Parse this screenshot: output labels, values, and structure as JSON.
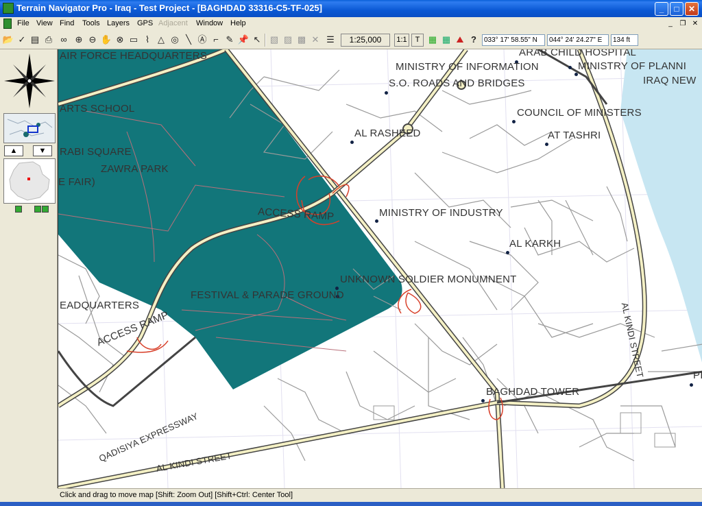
{
  "window": {
    "title": "Terrain Navigator Pro - Iraq - Test Project - [BAGHDAD 33316-C5-TF-025]",
    "controls": {
      "minimize": "_",
      "maximize": "□",
      "close": "✕"
    }
  },
  "menu": {
    "items": [
      "File",
      "View",
      "Find",
      "Tools",
      "Layers",
      "GPS",
      "Adjacent",
      "Window",
      "Help"
    ],
    "disabled": [
      "Adjacent"
    ],
    "mdi_controls": {
      "minimize": "_",
      "restore": "❐",
      "close": "✕"
    }
  },
  "toolbar": {
    "scale": "1:25,000",
    "ratio_button": "1:1",
    "text_button": "T",
    "help_button": "?",
    "latitude": "033° 17' 58.55\" N",
    "longitude": "044° 24' 24.27\" E",
    "elevation": "134 ft",
    "icons": [
      "open-folder-icon",
      "check-icon",
      "print-preview-icon",
      "print-icon",
      "binoculars-icon",
      "zoom-in-icon",
      "zoom-out-icon",
      "hand-pan-icon",
      "center-icon",
      "ruler-icon",
      "profile-icon",
      "triangle-icon",
      "target-icon",
      "line-icon",
      "text-tool-icon",
      "measure-icon",
      "pencil-icon",
      "pushpin-icon",
      "arrow-select-icon",
      "route-icon",
      "layer-icon",
      "terrain-icon",
      "delete-icon",
      "lines-icon"
    ]
  },
  "left_panel": {
    "up_arrow": "▲",
    "down_arrow": "▼",
    "compass_north": "N"
  },
  "map": {
    "labels": [
      {
        "text": "AIR FORCE HEADQUARTERS",
        "dot": false
      },
      {
        "text": "ARTS SCHOOL",
        "dot": false
      },
      {
        "text": "RABI SQUARE",
        "dot": false
      },
      {
        "text": "ZAWRA PARK",
        "dot": false
      },
      {
        "text": "E FAIR)",
        "dot": false
      },
      {
        "text": "ARAB CHILD HOSPITAL",
        "dot": true
      },
      {
        "text": "MINISTRY OF INFORMATION",
        "dot": false
      },
      {
        "text": "MINISTRY OF PLANNI",
        "dot": true
      },
      {
        "text": "IRAQ NEW",
        "dot": false
      },
      {
        "text": "S.O. ROADS AND BRIDGES",
        "dot": true
      },
      {
        "text": "COUNCIL OF MINISTERS",
        "dot": true
      },
      {
        "text": "AL RASHEED",
        "dot": true
      },
      {
        "text": "AT TASHRI",
        "dot": true
      },
      {
        "text": "ACCESS RAMP",
        "dot": false
      },
      {
        "text": "MINISTRY OF INDUSTRY",
        "dot": true
      },
      {
        "text": "AL KARKH",
        "dot": true
      },
      {
        "text": "UNKNOWN SOLDIER MONUMNENT",
        "dot": true
      },
      {
        "text": "EADQUARTERS",
        "dot": false
      },
      {
        "text": "FESTIVAL & PARADE GROUND",
        "dot": true
      },
      {
        "text": "ACCESS RAMP",
        "dot": false
      },
      {
        "text": "AL KINDI STREET",
        "dot": false
      },
      {
        "text": "BAGHDAD TOWER",
        "dot": true
      },
      {
        "text": "QADISIYA EXPRESSWAY",
        "dot": false
      },
      {
        "text": "AL KINDI STREET",
        "dot": false
      },
      {
        "text": "PI",
        "dot": true
      }
    ],
    "colors": {
      "park": "#12767a",
      "water": "#c7e6f2",
      "highway_fill": "#f4f0c4",
      "highway_edge": "#444444",
      "street": "#9a9a9a",
      "ramp": "#d8402a",
      "park_path": "#b8707a",
      "grid": "#e4e2f2"
    }
  },
  "status": {
    "text": "Click and drag to move map [Shift: Zoom Out] [Shift+Ctrl: Center Tool]"
  }
}
